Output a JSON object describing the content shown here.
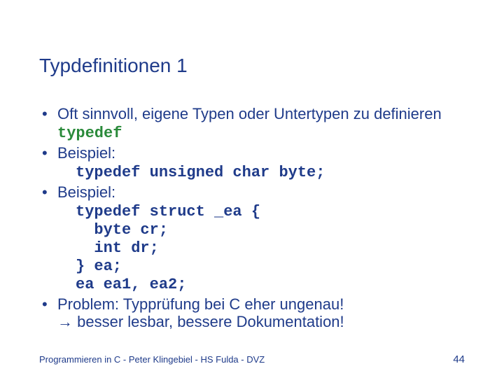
{
  "title": "Typdefinitionen 1",
  "b1_a": "Oft sinnvoll, eigene Typen oder Untertypen zu definieren ",
  "b1_kw": "typedef",
  "b2": "Beispiel:",
  "code1": "typedef unsigned char byte;",
  "b3": "Beispiel:",
  "code2": "typedef struct _ea {\n  byte cr;\n  int dr;\n} ea;\nea ea1, ea2;",
  "b4_a": "Problem: Typprüfung bei C eher ungenau!",
  "b4_arrow": "→",
  "b4_b": " besser lesbar, bessere Dokumentation!",
  "footer": "Programmieren in C - Peter Klingebiel - HS Fulda - DVZ",
  "page": "44"
}
